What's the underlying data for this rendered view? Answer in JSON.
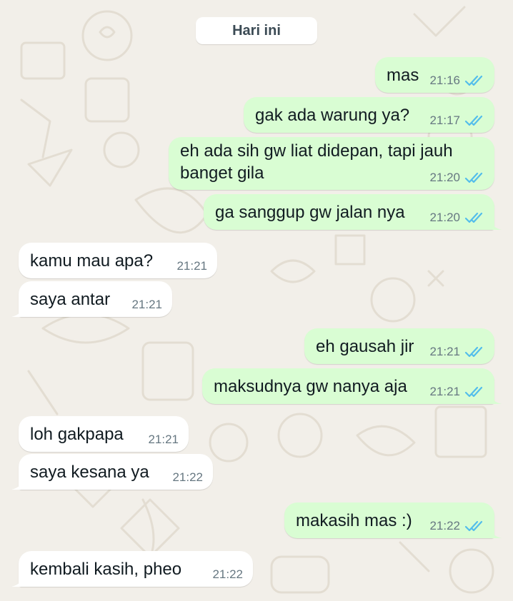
{
  "day_divider": "Hari ini",
  "messages": [
    {
      "dir": "out",
      "text": "mas",
      "time": "21:16"
    },
    {
      "dir": "out",
      "text": "gak ada warung ya?",
      "time": "21:17"
    },
    {
      "dir": "out",
      "text": "eh ada sih gw liat didepan, tapi jauh banget gila",
      "time": "21:20"
    },
    {
      "dir": "out",
      "text": "ga sanggup gw jalan nya",
      "time": "21:20"
    },
    {
      "dir": "in",
      "text": "kamu mau apa?",
      "time": "21:21"
    },
    {
      "dir": "in",
      "text": "saya antar",
      "time": "21:21"
    },
    {
      "dir": "out",
      "text": "eh gausah jir",
      "time": "21:21"
    },
    {
      "dir": "out",
      "text": "maksudnya gw nanya aja",
      "time": "21:21"
    },
    {
      "dir": "in",
      "text": "loh gakpapa",
      "time": "21:21"
    },
    {
      "dir": "in",
      "text": "saya kesana ya",
      "time": "21:22"
    },
    {
      "dir": "out",
      "text": "makasih mas :)",
      "time": "21:22"
    },
    {
      "dir": "in",
      "text": "kembali kasih, pheo",
      "time": "21:22"
    }
  ],
  "colors": {
    "outgoing_bubble": "#d9fdd3",
    "incoming_bubble": "#ffffff",
    "read_ticks": "#53bdeb",
    "time_text": "#667781"
  },
  "icons": {
    "read_receipt": "double-check-icon"
  }
}
